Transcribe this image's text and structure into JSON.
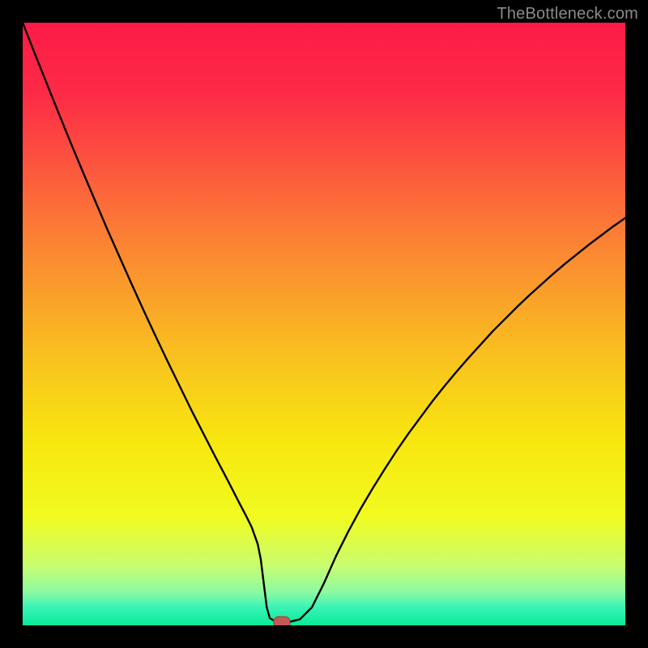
{
  "watermark": {
    "text": "TheBottleneck.com"
  },
  "colors": {
    "gradient_stops": [
      {
        "offset": 0.0,
        "color": "#fd1b47"
      },
      {
        "offset": 0.12,
        "color": "#fd2b46"
      },
      {
        "offset": 0.25,
        "color": "#fc5a3d"
      },
      {
        "offset": 0.4,
        "color": "#fb8f30"
      },
      {
        "offset": 0.55,
        "color": "#f9c01f"
      },
      {
        "offset": 0.7,
        "color": "#f7e80f"
      },
      {
        "offset": 0.82,
        "color": "#f1fb20"
      },
      {
        "offset": 0.9,
        "color": "#c9fd6f"
      },
      {
        "offset": 0.945,
        "color": "#8cfaa2"
      },
      {
        "offset": 0.97,
        "color": "#3af3b5"
      },
      {
        "offset": 1.0,
        "color": "#07eb9a"
      }
    ],
    "curve": "#000000",
    "marker_fill": "#c35a54",
    "marker_stroke": "#9e3f3a",
    "frame": "#000000"
  },
  "chart_data": {
    "type": "line",
    "title": "",
    "xlabel": "",
    "ylabel": "",
    "xlim": [
      0,
      100
    ],
    "ylim": [
      0,
      100
    ],
    "x": [
      0,
      2,
      4,
      6,
      8,
      10,
      12,
      14,
      16,
      18,
      20,
      22,
      24,
      26,
      28,
      30,
      32,
      34,
      36,
      37,
      38,
      39,
      39.5,
      40,
      40.5,
      41,
      42,
      43,
      44,
      46,
      48,
      50,
      52,
      54,
      56,
      58,
      60,
      62,
      64,
      66,
      68,
      70,
      72,
      74,
      76,
      78,
      80,
      82,
      84,
      86,
      88,
      90,
      92,
      94,
      96,
      98,
      100
    ],
    "values": [
      100.0,
      94.9,
      89.9,
      84.9,
      80.0,
      75.2,
      70.5,
      65.8,
      61.3,
      56.8,
      52.4,
      48.1,
      43.9,
      39.8,
      35.7,
      31.8,
      27.9,
      24.1,
      20.2,
      18.3,
      16.3,
      13.5,
      11.0,
      7.0,
      3.0,
      1.2,
      0.6,
      0.5,
      0.5,
      1.0,
      3.0,
      7.0,
      11.5,
      15.5,
      19.2,
      22.6,
      25.8,
      28.9,
      31.8,
      34.5,
      37.2,
      39.7,
      42.1,
      44.4,
      46.6,
      48.8,
      50.8,
      52.8,
      54.7,
      56.5,
      58.3,
      60.0,
      61.6,
      63.2,
      64.7,
      66.2,
      67.6
    ],
    "marker": {
      "x": 43,
      "y": 0.5
    },
    "grid": false,
    "legend": false
  }
}
